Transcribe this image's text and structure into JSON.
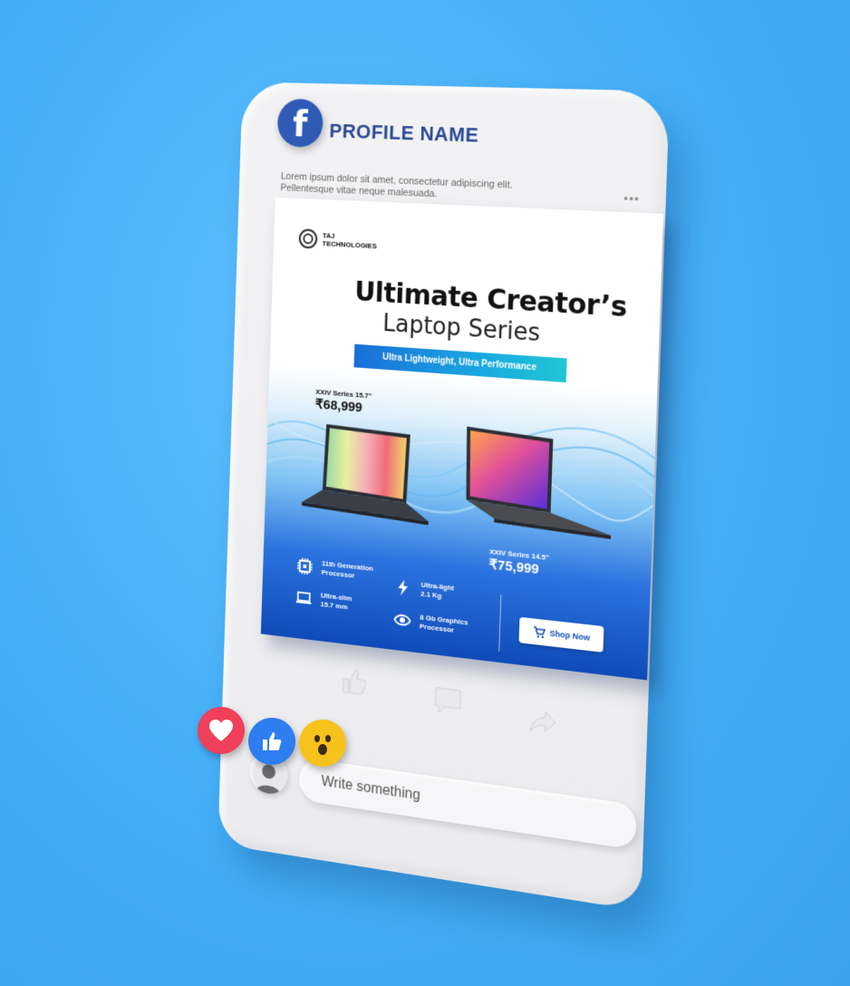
{
  "post": {
    "profile_name": "PROFILE  NAME",
    "caption_line1": "Lorem ipsum dolor sit amet, consectetur adipiscing elit.",
    "caption_line2": "Pellentesque vitae neque malesuada.",
    "logo_letter": "f",
    "more": "•••"
  },
  "ad": {
    "brand_line1": "TAJ",
    "brand_line2": "TECHNOLOGIES",
    "title_line1": "Ultimate Creator’s",
    "title_line2": "Laptop Series",
    "ribbon": "Ultra Lightweight, Ultra Performance",
    "product_a": {
      "series": "XXIV Series 15.7\"",
      "price": "₹68,999"
    },
    "product_b": {
      "series": "XXIV Series 14.5\"",
      "price": "₹75,999"
    },
    "features": [
      {
        "line1": "11th Generation",
        "line2": "Processor",
        "icon": "chip-icon"
      },
      {
        "line1": "Ultra-light",
        "line2": "2.1 Kg",
        "icon": "bolt-icon"
      },
      {
        "line1": "Ultra-slim",
        "line2": "15.7 mm",
        "icon": "laptop-icon"
      },
      {
        "line1": "8 Gb Graphics",
        "line2": "Processor",
        "icon": "eye-icon"
      }
    ],
    "cta": "Shop Now"
  },
  "comment": {
    "placeholder": "Write something"
  },
  "colors": {
    "background": "#42aef7",
    "facebook_blue": "#2f5bb7",
    "love": "#f0405a",
    "like": "#2f7ef0",
    "wow": "#f7c21c"
  }
}
